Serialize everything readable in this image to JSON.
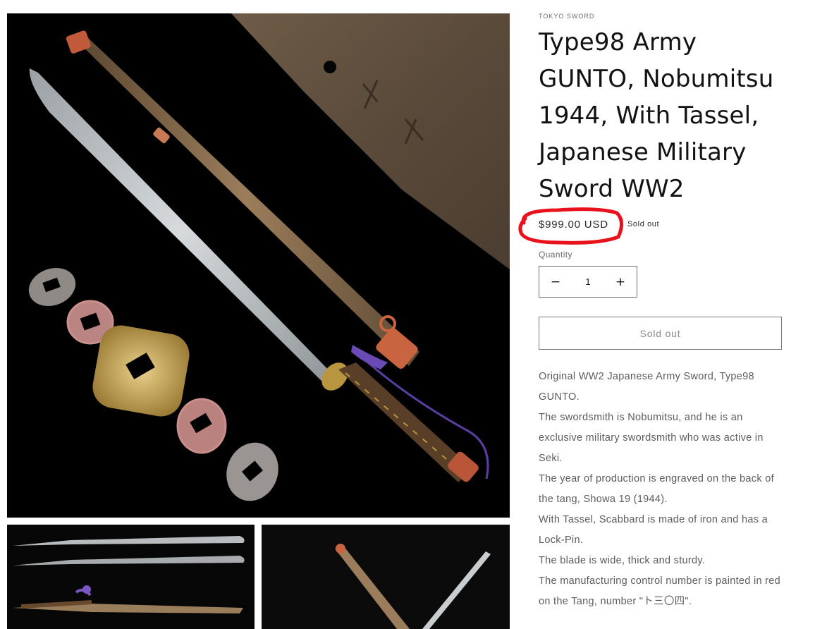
{
  "product": {
    "vendor": "TOKYO SWORD",
    "title": "Type98 Army GUNTO, Nobumitsu 1944, With Tassel, Japanese Military Sword WW2",
    "price": "$999.00 USD",
    "badge": "Sold out",
    "quantity_label": "Quantity",
    "quantity_value": "1",
    "decrease_symbol": "−",
    "increase_symbol": "+",
    "buy_button_label": "Sold out",
    "description": [
      "Original WW2 Japanese Army Sword, Type98 GUNTO.",
      "The swordsmith is Nobumitsu, and he is an exclusive military swordsmith who was active in Seki.",
      "The year of production is engraved on the back of the tang, Showa 19 (1944).",
      "With Tassel, Scabbard is made of iron and has a Lock-Pin.",
      "The blade is wide, thick and sturdy.",
      "The manufacturing control number is painted in red on the Tang, number \"ト三〇四\"."
    ]
  },
  "annotation": {
    "color": "#e8121c"
  },
  "icons": {
    "minus": "minus-icon",
    "plus": "plus-icon"
  }
}
